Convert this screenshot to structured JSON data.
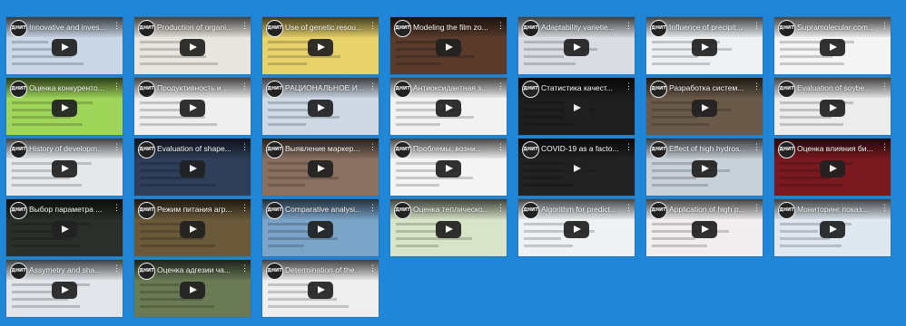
{
  "page": {
    "background_color": "#1f86d8"
  },
  "channel_logo_text": "ДНИТ",
  "videos": [
    {
      "title": "Innovative and inves...",
      "bg": "#c9d7e6"
    },
    {
      "title": "Production of organi...",
      "bg": "#e8e6de"
    },
    {
      "title": "Use of genetic resou...",
      "bg": "#e8d26a"
    },
    {
      "title": "Modeling the film zo...",
      "bg": "#5a3b2c"
    },
    {
      "title": "Adaptability varietie...",
      "bg": "#d9dce2"
    },
    {
      "title": "Influence of precipit...",
      "bg": "#eef0f2"
    },
    {
      "title": "Supramolecular com...",
      "bg": "#f4f4f4"
    },
    {
      "title": "Оценка конкуренто...",
      "bg": "#9fd65a"
    },
    {
      "title": "Продуктивность и ...",
      "bg": "#eeeeee"
    },
    {
      "title": "РАЦИОНАЛЬНОЕ И...",
      "bg": "#cfd9e6"
    },
    {
      "title": "Антиоксидантная з...",
      "bg": "#f2f2f2"
    },
    {
      "title": "Статистика качест...",
      "bg": "#1e1e1e"
    },
    {
      "title": "Разработка систем...",
      "bg": "#6a5a4a"
    },
    {
      "title": "Evaluation of soybe...",
      "bg": "#ececec"
    },
    {
      "title": "History of developm...",
      "bg": "#e6e8ea"
    },
    {
      "title": "Evaluation of shape...",
      "bg": "#2f3f5a"
    },
    {
      "title": "Выявление маркер...",
      "bg": "#8a7060"
    },
    {
      "title": "Проблемы, возни...",
      "bg": "#f4f4f4"
    },
    {
      "title": "COVID-19 as a facto...",
      "bg": "#222222"
    },
    {
      "title": "Effect of high hydros...",
      "bg": "#c8d0d8"
    },
    {
      "title": "Оценка влияния би...",
      "bg": "#7a1a20"
    },
    {
      "title": "Выбор параметра ...",
      "bg": "#2a2f2a"
    },
    {
      "title": "Режим питания агр...",
      "bg": "#6a5a3a"
    },
    {
      "title": "Comparative analysi...",
      "bg": "#7aa4c8"
    },
    {
      "title": "Оценка теплическо...",
      "bg": "#d8e4c8"
    },
    {
      "title": "Algorithm for predict...",
      "bg": "#eef2f4"
    },
    {
      "title": "Application of high p...",
      "bg": "#f0eeee"
    },
    {
      "title": "Мониторинг показ...",
      "bg": "#dfe7f0"
    },
    {
      "title": "Assymetry and sha...",
      "bg": "#e2e6ea"
    },
    {
      "title": "Оценка адгезии ча...",
      "bg": "#6a7a55"
    },
    {
      "title": "Determination of the...",
      "bg": "#eeeeee"
    }
  ]
}
